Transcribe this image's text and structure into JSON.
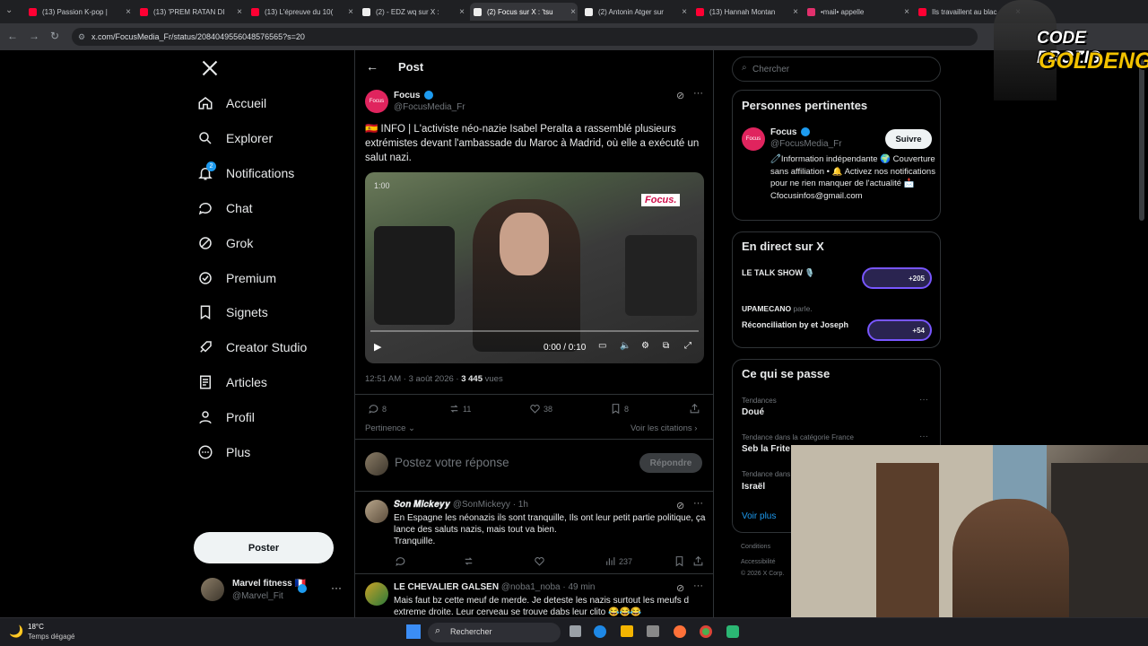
{
  "browser": {
    "tabs": [
      {
        "label": "(13) Passion K-pop |",
        "icon": "youtube-icon"
      },
      {
        "label": "(13) 'PREM RATAN DI",
        "icon": "youtube-icon"
      },
      {
        "label": "(13) L'épreuve du 10(",
        "icon": "youtube-icon"
      },
      {
        "label": "(2) - EDZ wq sur X :",
        "icon": "x-icon"
      },
      {
        "label": "(2) Focus sur X : 'tsu",
        "icon": "x-icon",
        "active": true
      },
      {
        "label": "(2) Antonin Atger sur",
        "icon": "x-icon"
      },
      {
        "label": "(13) Hannah Montan",
        "icon": "youtube-icon"
      },
      {
        "label": "•mail• appelle",
        "icon": "instagram-icon"
      },
      {
        "label": "Ils travaillent au blac",
        "icon": "youtube-icon"
      }
    ],
    "url": "x.com/FocusMedia_Fr/status/2084049556048576565?s=20"
  },
  "sidebar": {
    "items": [
      {
        "label": "Accueil",
        "icon": "home-icon"
      },
      {
        "label": "Explorer",
        "icon": "search-icon"
      },
      {
        "label": "Notifications",
        "icon": "bell-icon",
        "badge": "2"
      },
      {
        "label": "Chat",
        "icon": "chat-icon"
      },
      {
        "label": "Grok",
        "icon": "grok-icon"
      },
      {
        "label": "Premium",
        "icon": "premium-icon"
      },
      {
        "label": "Signets",
        "icon": "bookmark-icon"
      },
      {
        "label": "Creator Studio",
        "icon": "rocket-icon"
      },
      {
        "label": "Articles",
        "icon": "article-icon"
      },
      {
        "label": "Profil",
        "icon": "person-icon"
      },
      {
        "label": "Plus",
        "icon": "more-circle-icon"
      }
    ],
    "post_button": "Poster",
    "account": {
      "name": "Marvel fitness 🇫🇷",
      "handle": "@Marvel_Fit"
    }
  },
  "post": {
    "header": "Post",
    "author": {
      "name": "Focus",
      "handle": "@FocusMedia_Fr"
    },
    "text": "🇪🇸 INFO | L'activiste néo-nazie Isabel Peralta a rassemblé plusieurs extrémistes devant l'ambassade du Maroc à Madrid, où elle a exécuté un salut nazi.",
    "video": {
      "badge": "Focus.",
      "timestamp_overlay": "1:00",
      "time": "0:00 / 0:10"
    },
    "meta": {
      "time": "12:51 AM · 3 août 2026 · ",
      "views": "3 445",
      "views_label": " vues"
    },
    "stats": {
      "replies": "8",
      "reposts": "11",
      "likes": "38",
      "bookmarks": "8"
    },
    "relevance": "Pertinence",
    "quotes": "Voir les citations",
    "reply_placeholder": "Postez votre réponse",
    "reply_button": "Répondre"
  },
  "replies": [
    {
      "name": "𝑺𝒐𝒏 𝑴𝒊𝒄𝒌𝒆𝒚𝒚",
      "handle": "@SonMickeyy · 1h",
      "text": "En Espagne les néonazis ils sont tranquille, Ils ont leur petit partie politique, ça lance des saluts nazis, mais tout va bien.\nTranquille.",
      "views": "237"
    },
    {
      "name": "LE CHEVALIER GALSEN",
      "handle": "@noba1_noba · 49 min",
      "text": "Mais faut bz cette meuf de merde. Je deteste les nazis surtout les meufs d extreme droite. Leur cerveau se trouve dabs leur clito 😂😂😂"
    }
  ],
  "right": {
    "search_placeholder": "Chercher",
    "relevant": {
      "title": "Personnes pertinentes",
      "name": "Focus",
      "handle": "@FocusMedia_Fr",
      "follow": "Suivre",
      "bio": "🧷Information indépendante 🌍 Couverture sans affiliation • 🔔 Activez nos notifications pour ne rien manquer de l'actualité 📩 Cfocusinfos@gmail.com"
    },
    "live": {
      "title": "En direct sur X",
      "items": [
        {
          "title": "LE TALK SHOW 🎙️",
          "count": "+205"
        },
        {
          "host": "UPAMECANO",
          "host_suffix": " parle.",
          "title": "Réconciliation by et Joseph",
          "count": "+54"
        }
      ]
    },
    "trends": {
      "title": "Ce qui se passe",
      "items": [
        {
          "category": "Tendances",
          "name": "Doué"
        },
        {
          "category": "Tendance dans la catégorie France",
          "name": "Seb la Frite"
        },
        {
          "category": "Tendance dans",
          "name": "Israël"
        }
      ],
      "more": "Voir plus"
    },
    "footer": [
      "Conditions",
      "Accessibilité",
      "© 2026 X Corp."
    ]
  },
  "taskbar": {
    "weather_temp": "18°C",
    "weather_desc": "Temps dégagé",
    "search": "Rechercher"
  },
  "overlay": {
    "logo_line1": "CODE PROZIS",
    "logo_line2": "GOLDENG"
  }
}
